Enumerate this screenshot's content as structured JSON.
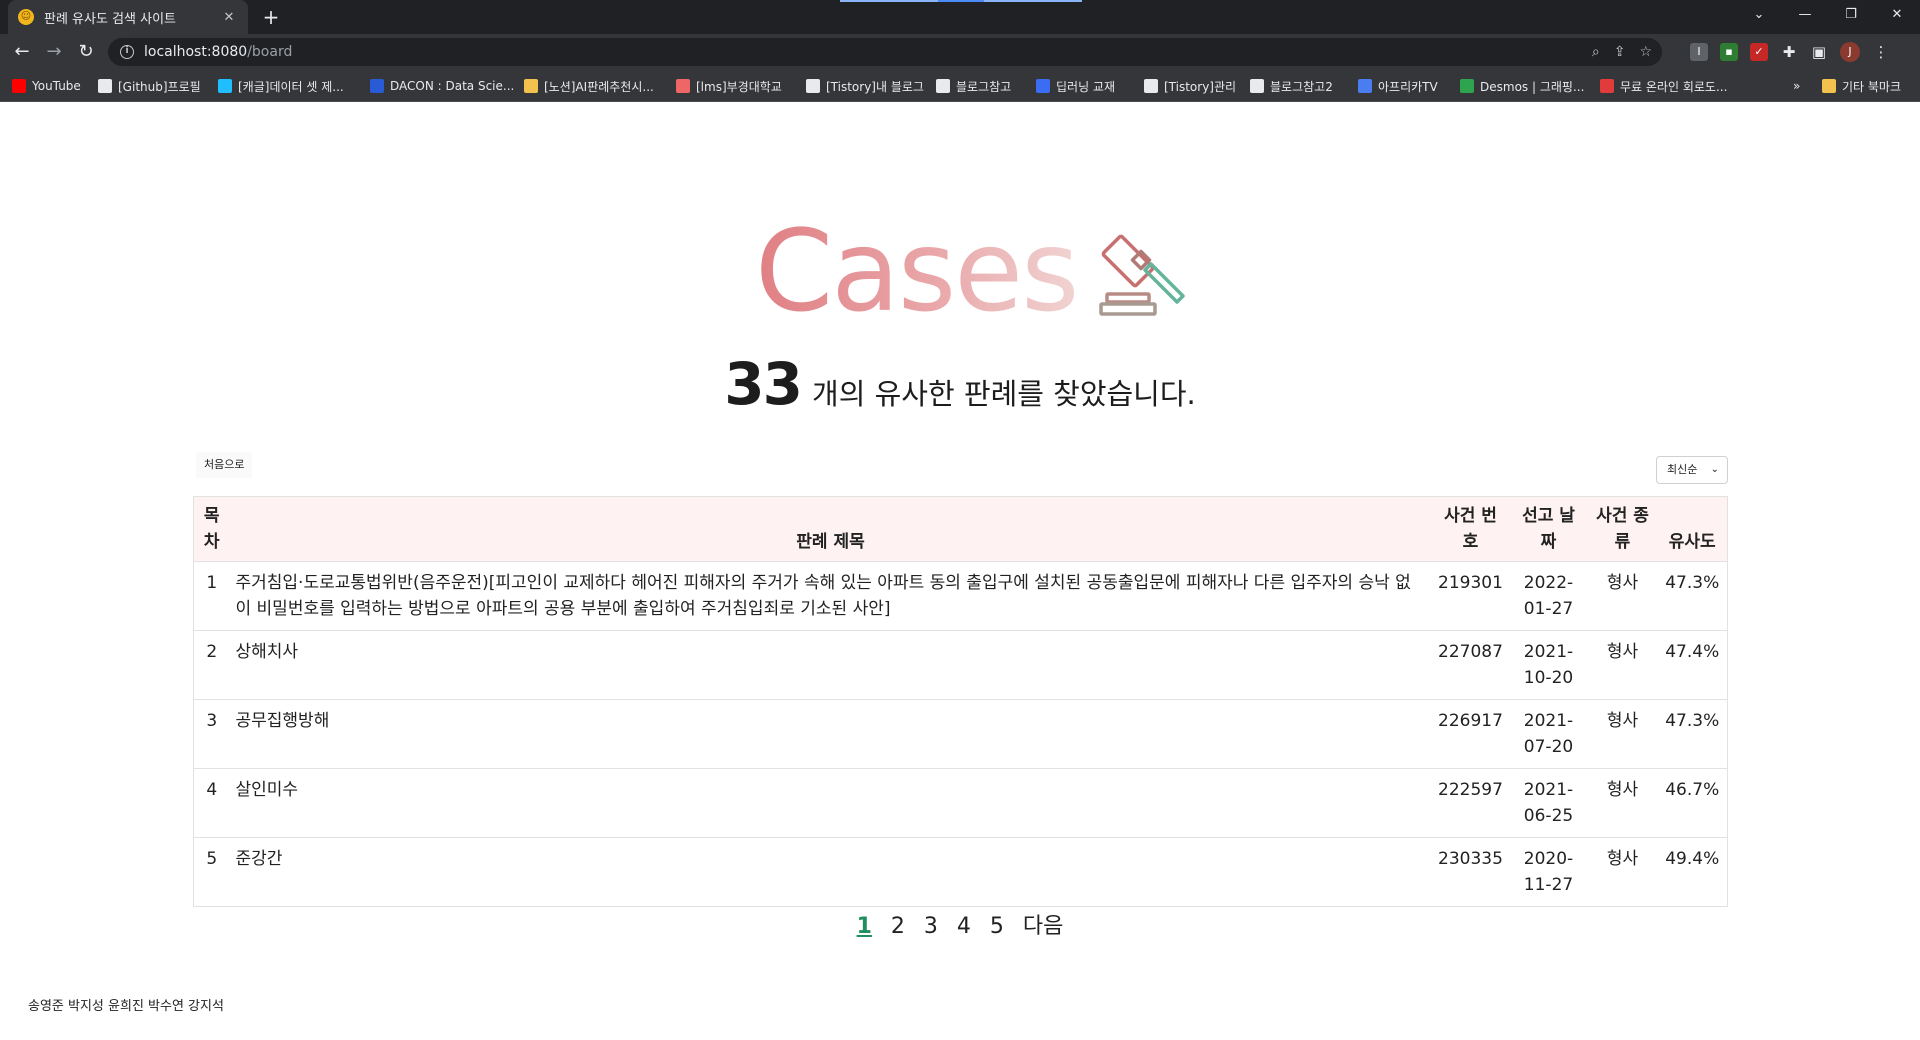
{
  "browser": {
    "tab_title": "판례 유사도 검색 사이트",
    "url_host": "localhost:8080",
    "url_path": "/board",
    "profile_initial": "J",
    "other_bookmarks": "기타 북마크",
    "bookmarks": [
      {
        "label": "YouTube",
        "icon": "youtube-icon",
        "color": "#ff0000"
      },
      {
        "label": "[Github]프로필",
        "icon": "github-icon",
        "color": "#e8eaed"
      },
      {
        "label": "[캐글]데이터 셋 제...",
        "icon": "kaggle-icon",
        "color": "#20beff"
      },
      {
        "label": "DACON : Data Scie...",
        "icon": "dacon-icon",
        "color": "#2a5bd7"
      },
      {
        "label": "[노션]AI판례추천시...",
        "icon": "bulb-icon",
        "color": "#f2c14e"
      },
      {
        "label": "[lms]부경대학교",
        "icon": "pinwheel-icon",
        "color": "#e66"
      },
      {
        "label": "[Tistory]내 블로그",
        "icon": "tistory-icon",
        "color": "#e8eaed"
      },
      {
        "label": "블로그참고",
        "icon": "tistory-icon",
        "color": "#e8eaed"
      },
      {
        "label": "딥러닝 교재",
        "icon": "book-icon",
        "color": "#3a6cf4"
      },
      {
        "label": "[Tistory]관리",
        "icon": "tistory-icon",
        "color": "#e8eaed"
      },
      {
        "label": "블로그참고2",
        "icon": "tistory-icon",
        "color": "#e8eaed"
      },
      {
        "label": "아프리카TV",
        "icon": "afreeca-icon",
        "color": "#4a7ef0"
      },
      {
        "label": "Desmos | 그래핑...",
        "icon": "desmos-icon",
        "color": "#2ea44f"
      },
      {
        "label": "무료 온라인 회로도...",
        "icon": "circuit-icon",
        "color": "#e23b3b"
      }
    ]
  },
  "page": {
    "logo_text": "Cases",
    "result_count": "33",
    "result_text": "개의 유사한 판례를 찾았습니다.",
    "first_button": "처음으로",
    "sort_value": "최신순",
    "table": {
      "headers": {
        "no": "목차",
        "title": "판례 제목",
        "case_number": "사건 번호",
        "date": "선고 날짜",
        "type": "사건 종류",
        "similarity": "유사도"
      },
      "rows": [
        {
          "no": "1",
          "title": "주거침입·도로교통법위반(음주운전)[피고인이 교제하다 헤어진 피해자의 주거가 속해 있는 아파트 동의 출입구에 설치된 공동출입문에 피해자나 다른 입주자의 승낙 없이 비밀번호를 입력하는 방법으로 아파트의 공용 부분에 출입하여 주거침입죄로 기소된 사안]",
          "case_number": "219301",
          "date": "2022-01-27",
          "type": "형사",
          "similarity": "47.3%"
        },
        {
          "no": "2",
          "title": "상해치사",
          "case_number": "227087",
          "date": "2021-10-20",
          "type": "형사",
          "similarity": "47.4%"
        },
        {
          "no": "3",
          "title": "공무집행방해",
          "case_number": "226917",
          "date": "2021-07-20",
          "type": "형사",
          "similarity": "47.3%"
        },
        {
          "no": "4",
          "title": "살인미수",
          "case_number": "222597",
          "date": "2021-06-25",
          "type": "형사",
          "similarity": "46.7%"
        },
        {
          "no": "5",
          "title": "준강간",
          "case_number": "230335",
          "date": "2020-11-27",
          "type": "형사",
          "similarity": "49.4%"
        }
      ]
    },
    "pagination": {
      "pages": [
        "1",
        "2",
        "3",
        "4",
        "5"
      ],
      "current": "1",
      "next_label": "다음"
    },
    "footer": "송영준 박지성 윤희진 박수연 강지석"
  },
  "colors": {
    "accent_active_page": "#1f8f5f",
    "table_header_bg": "#fff2f2",
    "logo_gradient_start": "#e07f84",
    "logo_gradient_end": "#f1d3d2"
  }
}
